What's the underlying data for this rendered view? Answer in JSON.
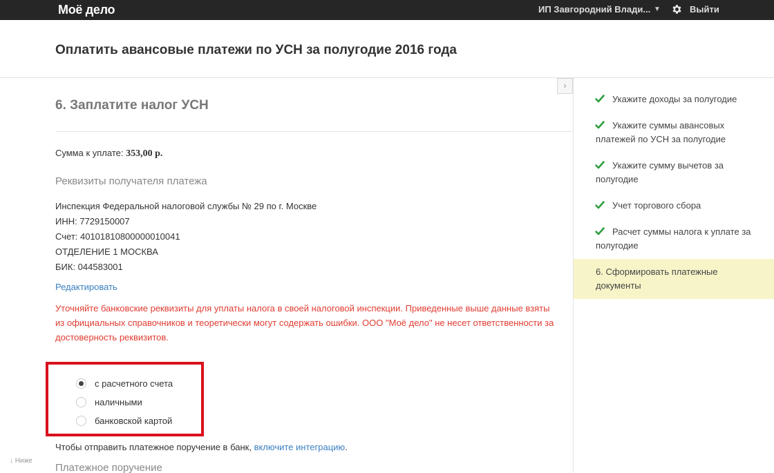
{
  "header": {
    "logo": "Моё дело",
    "user": "ИП Завгородний Влади...",
    "logout": "Выйти"
  },
  "page": {
    "title": "Оплатить авансовые платежи по УСН за полугодие 2016 года"
  },
  "section": {
    "title": "6. Заплатите налог УСН",
    "sum_label": "Сумма к уплате:",
    "sum_value": "353,00 р.",
    "requisites_title": "Реквизиты получателя платежа",
    "requisites": [
      "Инспекция Федеральной налоговой службы № 29 по г. Москве",
      "ИНН: 7729150007",
      "Счет: 40101810800000010041",
      "ОТДЕЛЕНИЕ 1 МОСКВА",
      "БИК: 044583001"
    ],
    "edit_link": "Редактировать",
    "warning": "Уточняйте банковские реквизиты для уплаты налога в своей налоговой инспекции. Приведенные выше данные взяты из официальных справочников и теоретически могут содержать ошибки. ООО \"Моё дело\" не несет ответственности за достоверность реквизитов.",
    "payment_methods": [
      {
        "label": "с расчетного счета",
        "selected": true
      },
      {
        "label": "наличными",
        "selected": false
      },
      {
        "label": "банковской картой",
        "selected": false
      }
    ],
    "send_text": "Чтобы отправить платежное поручение в банк,",
    "send_link": "включите интеграцию",
    "send_suffix": ".",
    "next_title": "Платежное поручение"
  },
  "sidebar": {
    "collapse_icon": "chevron-right-icon",
    "steps": [
      {
        "label": "Укажите доходы за полугодие",
        "done": true
      },
      {
        "label": "Укажите суммы авансовых платежей по УСН за полугодие",
        "done": true
      },
      {
        "label": "Укажите сумму вычетов за полугодие",
        "done": true
      },
      {
        "label": "Учет торгового сбора",
        "done": true
      },
      {
        "label": "Расчет суммы налога к уплате за полугодие",
        "done": true
      },
      {
        "label": "6.  Сформировать платежные документы",
        "done": false
      }
    ]
  },
  "scroll_hint": "↓ Ниже",
  "colors": {
    "topbar": "#262626",
    "link": "#3a7fc0",
    "warning": "#e03c31",
    "check": "#2e9e3e",
    "active_step": "#f7f5c8",
    "highlight_box": "#d8111c"
  }
}
